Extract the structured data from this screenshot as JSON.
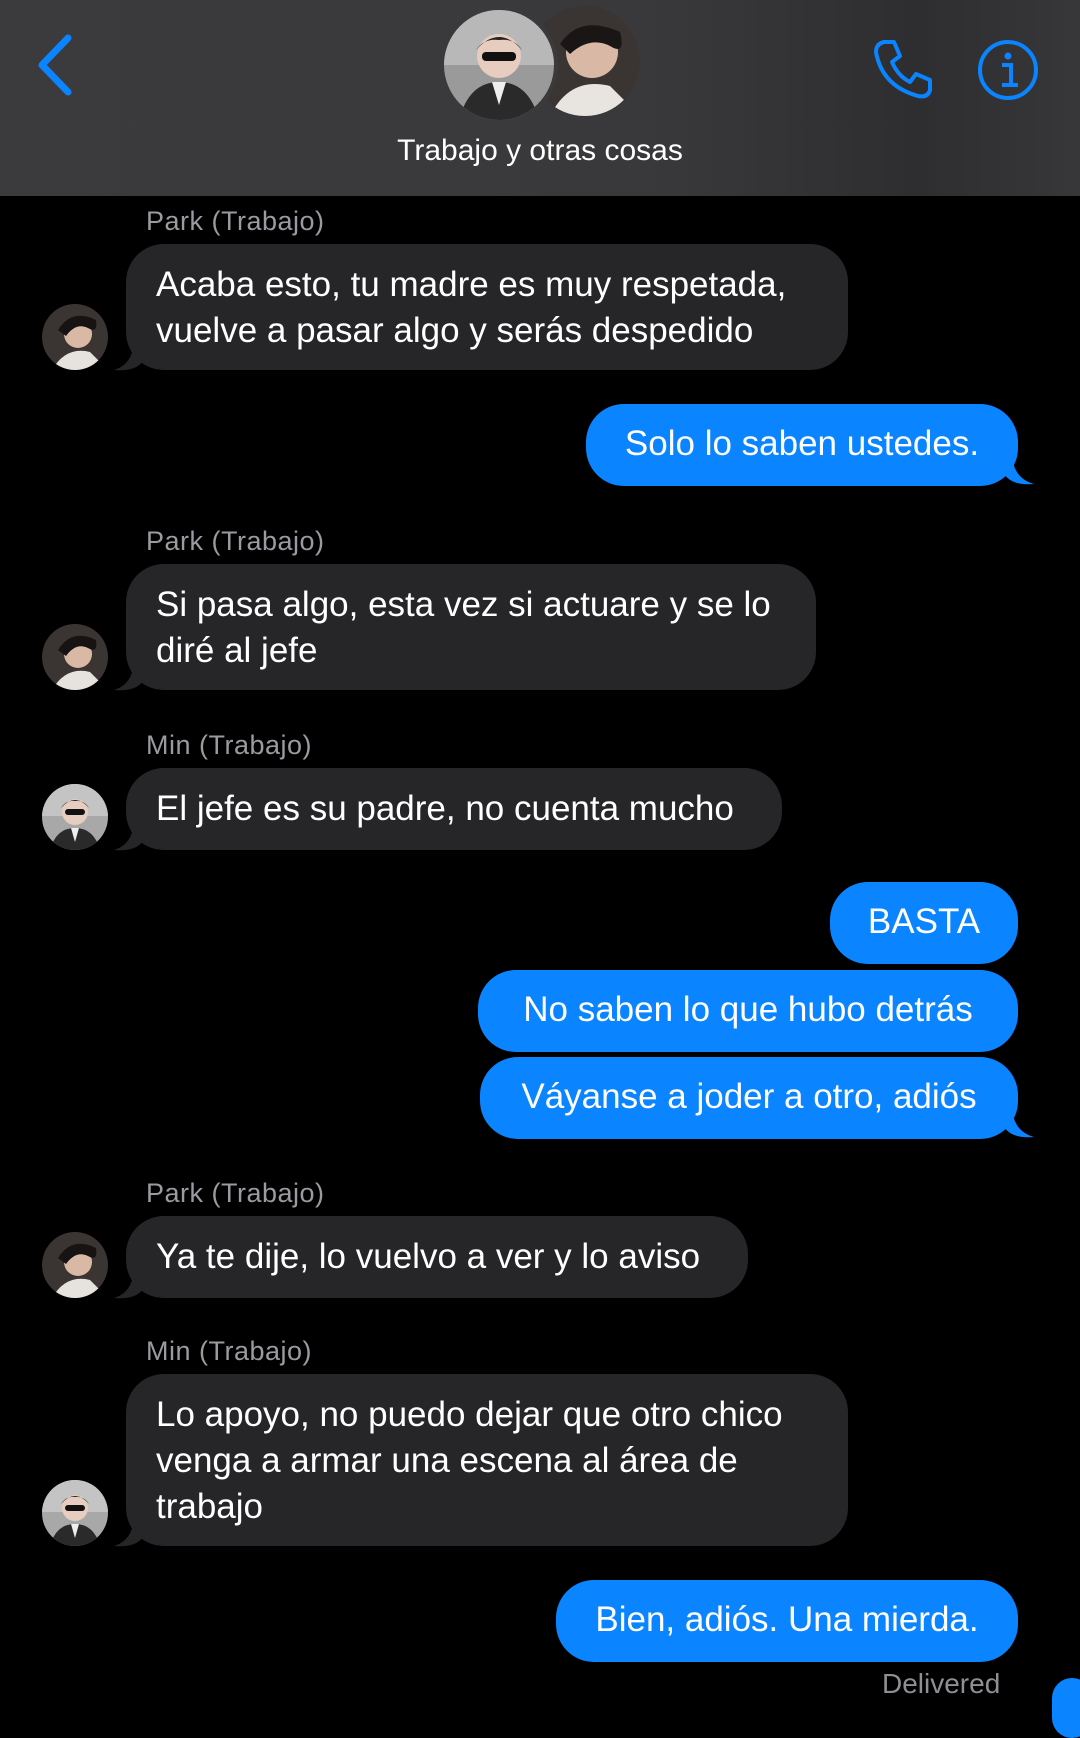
{
  "header": {
    "title": "Trabajo y otras cosas",
    "back_icon": "chevron-left-icon",
    "call_icon": "phone-icon",
    "info_icon": "info-icon",
    "accent": "#0a84ff"
  },
  "messages": [
    {
      "sender": "Park (Trabajo)",
      "lines": [
        "Acaba esto, tu madre es muy respetada,",
        "vuelve a pasar algo y serás despedido"
      ]
    },
    {
      "text": "Solo lo saben ustedes."
    },
    {
      "sender": "Park (Trabajo)",
      "lines": [
        "Si pasa algo, esta vez si actuare y se lo",
        "diré al jefe"
      ]
    },
    {
      "sender": "Min (Trabajo)",
      "lines": [
        "El jefe es su padre, no cuenta mucho"
      ]
    },
    {
      "text": "BASTA"
    },
    {
      "text": "No saben lo que hubo detrás"
    },
    {
      "text": "Váyanse a joder a otro, adiós"
    },
    {
      "sender": "Park (Trabajo)",
      "lines": [
        "Ya te dije, lo vuelvo a ver y lo aviso"
      ]
    },
    {
      "sender": "Min (Trabajo)",
      "lines": [
        "Lo apoyo, no puedo dejar que otro chico",
        "venga a armar una escena al área de",
        "trabajo"
      ]
    },
    {
      "text": "Bien, adiós. Una mierda."
    }
  ],
  "status": {
    "delivered": "Delivered"
  },
  "colors": {
    "outgoing": "#0a84ff",
    "incoming": "#262628",
    "header_bg": "#3a3a3c",
    "sender_label": "#9a9aa0"
  }
}
